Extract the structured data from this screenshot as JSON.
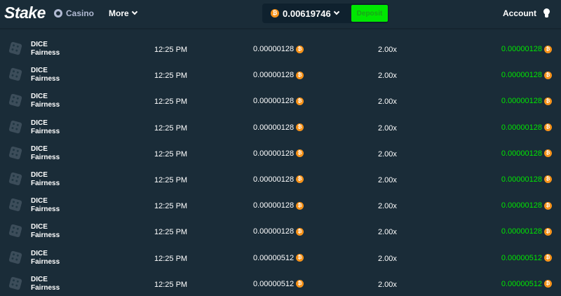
{
  "header": {
    "logo": "Stake",
    "nav": {
      "casino": "Casino",
      "more": "More"
    },
    "wallet": {
      "balance": "0.00619746",
      "currency_icon": "bitcoin-icon",
      "deposit_label": "Deposit"
    },
    "account_label": "Account",
    "colors": {
      "accent_green": "#00e701",
      "bitcoin_orange": "#f7931a",
      "background": "#1a2c38"
    }
  },
  "bets": [
    {
      "game": "DICE",
      "link": "Fairness",
      "time": "12:25 PM",
      "bet": "0.00000128",
      "multiplier": "2.00x",
      "payout": "0.00000128"
    },
    {
      "game": "DICE",
      "link": "Fairness",
      "time": "12:25 PM",
      "bet": "0.00000128",
      "multiplier": "2.00x",
      "payout": "0.00000128"
    },
    {
      "game": "DICE",
      "link": "Fairness",
      "time": "12:25 PM",
      "bet": "0.00000128",
      "multiplier": "2.00x",
      "payout": "0.00000128"
    },
    {
      "game": "DICE",
      "link": "Fairness",
      "time": "12:25 PM",
      "bet": "0.00000128",
      "multiplier": "2.00x",
      "payout": "0.00000128"
    },
    {
      "game": "DICE",
      "link": "Fairness",
      "time": "12:25 PM",
      "bet": "0.00000128",
      "multiplier": "2.00x",
      "payout": "0.00000128"
    },
    {
      "game": "DICE",
      "link": "Fairness",
      "time": "12:25 PM",
      "bet": "0.00000128",
      "multiplier": "2.00x",
      "payout": "0.00000128"
    },
    {
      "game": "DICE",
      "link": "Fairness",
      "time": "12:25 PM",
      "bet": "0.00000128",
      "multiplier": "2.00x",
      "payout": "0.00000128"
    },
    {
      "game": "DICE",
      "link": "Fairness",
      "time": "12:25 PM",
      "bet": "0.00000128",
      "multiplier": "2.00x",
      "payout": "0.00000128"
    },
    {
      "game": "DICE",
      "link": "Fairness",
      "time": "12:25 PM",
      "bet": "0.00000512",
      "multiplier": "2.00x",
      "payout": "0.00000512"
    },
    {
      "game": "DICE",
      "link": "Fairness",
      "time": "12:25 PM",
      "bet": "0.00000512",
      "multiplier": "2.00x",
      "payout": "0.00000512"
    }
  ]
}
